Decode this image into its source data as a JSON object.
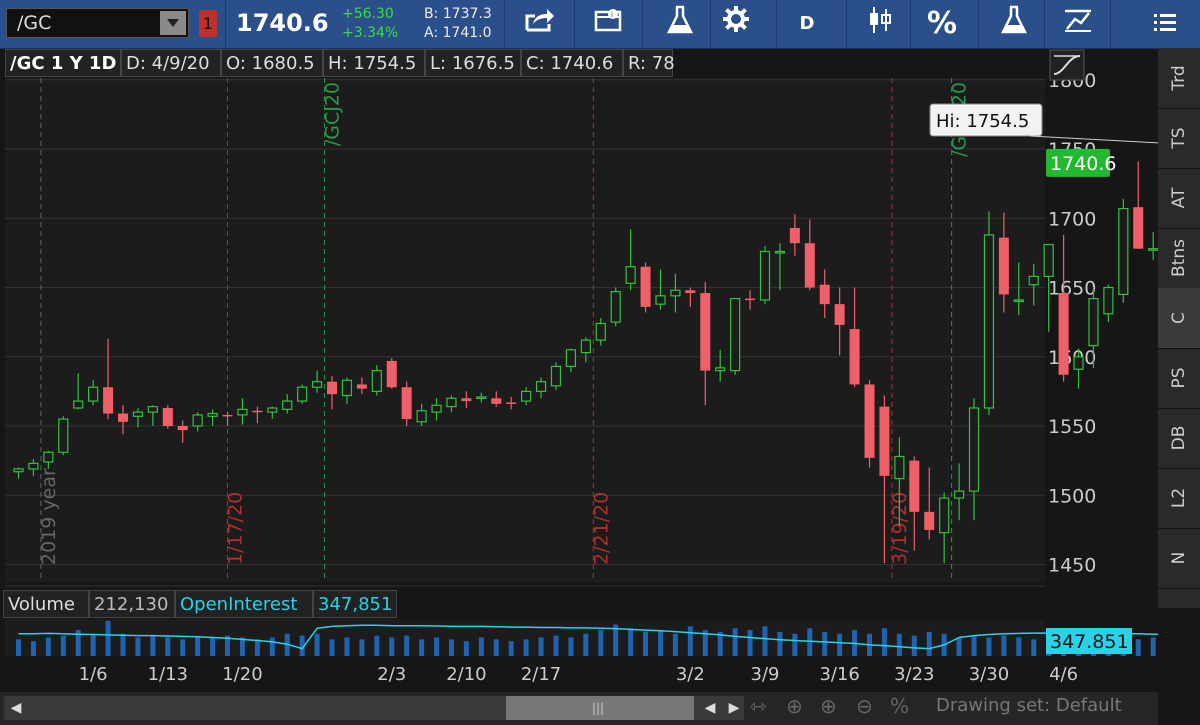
{
  "toolbar": {
    "symbol": "/GC",
    "link_badge": "1",
    "last_price": "1740.6",
    "net_change": "+56.30",
    "pct_change": "+3.34%",
    "bid": "B: 1737.3",
    "ask": "A: 1741.0",
    "aggregation_label": "D",
    "percent_label": "%"
  },
  "chart_header": {
    "title": "/GC 1 Y 1D",
    "date": "D: 4/9/20",
    "open": "O: 1680.5",
    "high": "H: 1754.5",
    "low": "L: 1676.5",
    "close": "C: 1740.6",
    "range": "R: 78"
  },
  "colors": {
    "up": "#35c040",
    "down": "#f06068",
    "grid": "#333333",
    "cyan": "#2ad2e8",
    "red_marker": "#b03030",
    "green_marker": "#2a9a4a",
    "price_badge": "#22b830"
  },
  "sidebar": {
    "tabs": [
      "Trd",
      "TS",
      "AT",
      "Btns",
      "C",
      "PS",
      "DB",
      "L2",
      "N"
    ],
    "active": "C"
  },
  "chart_data": {
    "type": "candlestick",
    "y_ticks": [
      1450,
      1500,
      1550,
      1600,
      1650,
      1700,
      1750,
      1800
    ],
    "ylim": [
      1440,
      1800
    ],
    "x_tick_labels": [
      "1/6",
      "1/13",
      "1/20",
      "2/3",
      "2/10",
      "2/17",
      "3/2",
      "3/9",
      "3/16",
      "3/23",
      "3/30",
      "4/6"
    ],
    "x_tick_indices": [
      5,
      10,
      15,
      25,
      30,
      35,
      45,
      50,
      55,
      60,
      65,
      70
    ],
    "high_annotation": "Hi: 1754.5",
    "last_price_label": "1740.6",
    "markers": [
      {
        "label": "2019 year",
        "index": 1.5,
        "color": "gray"
      },
      {
        "label": "1/17/20",
        "index": 14,
        "color": "red"
      },
      {
        "label": "/GCJ20",
        "index": 20.5,
        "color": "green"
      },
      {
        "label": "2/21/20",
        "index": 38.5,
        "color": "red"
      },
      {
        "label": "3/19/20",
        "index": 58.5,
        "color": "red"
      },
      {
        "label": "/GCM20",
        "index": 62.5,
        "color": "green"
      }
    ],
    "candles": [
      {
        "o": 1517,
        "h": 1520,
        "l": 1512,
        "c": 1519
      },
      {
        "o": 1519,
        "h": 1526,
        "l": 1514,
        "c": 1523
      },
      {
        "o": 1524,
        "h": 1532,
        "l": 1519,
        "c": 1531
      },
      {
        "o": 1531,
        "h": 1557,
        "l": 1529,
        "c": 1555
      },
      {
        "o": 1563,
        "h": 1588,
        "l": 1562,
        "c": 1568
      },
      {
        "o": 1568,
        "h": 1583,
        "l": 1565,
        "c": 1578
      },
      {
        "o": 1578,
        "h": 1613,
        "l": 1555,
        "c": 1559
      },
      {
        "o": 1559,
        "h": 1565,
        "l": 1544,
        "c": 1553
      },
      {
        "o": 1557,
        "h": 1563,
        "l": 1549,
        "c": 1560
      },
      {
        "o": 1560,
        "h": 1565,
        "l": 1550,
        "c": 1564
      },
      {
        "o": 1563,
        "h": 1565,
        "l": 1548,
        "c": 1550
      },
      {
        "o": 1550,
        "h": 1554,
        "l": 1538,
        "c": 1547
      },
      {
        "o": 1550,
        "h": 1560,
        "l": 1546,
        "c": 1558
      },
      {
        "o": 1557,
        "h": 1562,
        "l": 1550,
        "c": 1559
      },
      {
        "o": 1558,
        "h": 1560,
        "l": 1550,
        "c": 1557
      },
      {
        "o": 1558,
        "h": 1570,
        "l": 1551,
        "c": 1562
      },
      {
        "o": 1561,
        "h": 1564,
        "l": 1552,
        "c": 1560
      },
      {
        "o": 1560,
        "h": 1564,
        "l": 1555,
        "c": 1563
      },
      {
        "o": 1562,
        "h": 1573,
        "l": 1559,
        "c": 1568
      },
      {
        "o": 1568,
        "h": 1580,
        "l": 1566,
        "c": 1578
      },
      {
        "o": 1578,
        "h": 1590,
        "l": 1574,
        "c": 1582
      },
      {
        "o": 1582,
        "h": 1586,
        "l": 1562,
        "c": 1573
      },
      {
        "o": 1572,
        "h": 1585,
        "l": 1566,
        "c": 1583
      },
      {
        "o": 1580,
        "h": 1585,
        "l": 1573,
        "c": 1577
      },
      {
        "o": 1575,
        "h": 1594,
        "l": 1572,
        "c": 1590
      },
      {
        "o": 1597,
        "h": 1599,
        "l": 1577,
        "c": 1578
      },
      {
        "o": 1578,
        "h": 1582,
        "l": 1550,
        "c": 1555
      },
      {
        "o": 1553,
        "h": 1566,
        "l": 1550,
        "c": 1561
      },
      {
        "o": 1560,
        "h": 1570,
        "l": 1554,
        "c": 1565
      },
      {
        "o": 1564,
        "h": 1572,
        "l": 1560,
        "c": 1570
      },
      {
        "o": 1570,
        "h": 1575,
        "l": 1563,
        "c": 1568
      },
      {
        "o": 1570,
        "h": 1574,
        "l": 1567,
        "c": 1571
      },
      {
        "o": 1570,
        "h": 1575,
        "l": 1564,
        "c": 1566
      },
      {
        "o": 1567,
        "h": 1571,
        "l": 1562,
        "c": 1566
      },
      {
        "o": 1568,
        "h": 1578,
        "l": 1565,
        "c": 1575
      },
      {
        "o": 1575,
        "h": 1585,
        "l": 1570,
        "c": 1582
      },
      {
        "o": 1579,
        "h": 1596,
        "l": 1576,
        "c": 1593
      },
      {
        "o": 1593,
        "h": 1606,
        "l": 1589,
        "c": 1605
      },
      {
        "o": 1603,
        "h": 1614,
        "l": 1596,
        "c": 1612
      },
      {
        "o": 1612,
        "h": 1628,
        "l": 1608,
        "c": 1624
      },
      {
        "o": 1625,
        "h": 1650,
        "l": 1622,
        "c": 1647
      },
      {
        "o": 1653,
        "h": 1692,
        "l": 1648,
        "c": 1665
      },
      {
        "o": 1665,
        "h": 1668,
        "l": 1632,
        "c": 1636
      },
      {
        "o": 1638,
        "h": 1663,
        "l": 1634,
        "c": 1644
      },
      {
        "o": 1644,
        "h": 1660,
        "l": 1632,
        "c": 1648
      },
      {
        "o": 1648,
        "h": 1650,
        "l": 1636,
        "c": 1646
      },
      {
        "o": 1646,
        "h": 1654,
        "l": 1565,
        "c": 1590
      },
      {
        "o": 1590,
        "h": 1605,
        "l": 1582,
        "c": 1592
      },
      {
        "o": 1590,
        "h": 1641,
        "l": 1587,
        "c": 1642
      },
      {
        "o": 1642,
        "h": 1648,
        "l": 1634,
        "c": 1641
      },
      {
        "o": 1641,
        "h": 1680,
        "l": 1638,
        "c": 1676
      },
      {
        "o": 1675,
        "h": 1682,
        "l": 1648,
        "c": 1676
      },
      {
        "o": 1693,
        "h": 1703,
        "l": 1673,
        "c": 1682
      },
      {
        "o": 1682,
        "h": 1699,
        "l": 1648,
        "c": 1650
      },
      {
        "o": 1652,
        "h": 1663,
        "l": 1628,
        "c": 1638
      },
      {
        "o": 1638,
        "h": 1650,
        "l": 1601,
        "c": 1623
      },
      {
        "o": 1620,
        "h": 1650,
        "l": 1578,
        "c": 1580
      },
      {
        "o": 1580,
        "h": 1583,
        "l": 1520,
        "c": 1527
      },
      {
        "o": 1564,
        "h": 1572,
        "l": 1451,
        "c": 1514
      },
      {
        "o": 1512,
        "h": 1542,
        "l": 1478,
        "c": 1528
      },
      {
        "o": 1525,
        "h": 1528,
        "l": 1460,
        "c": 1488
      },
      {
        "o": 1488,
        "h": 1520,
        "l": 1468,
        "c": 1475
      },
      {
        "o": 1473,
        "h": 1502,
        "l": 1451,
        "c": 1498
      },
      {
        "o": 1498,
        "h": 1523,
        "l": 1482,
        "c": 1503
      },
      {
        "o": 1503,
        "h": 1570,
        "l": 1482,
        "c": 1563
      },
      {
        "o": 1563,
        "h": 1705,
        "l": 1558,
        "c": 1688
      },
      {
        "o": 1686,
        "h": 1704,
        "l": 1632,
        "c": 1645
      },
      {
        "o": 1640,
        "h": 1668,
        "l": 1630,
        "c": 1641
      },
      {
        "o": 1652,
        "h": 1667,
        "l": 1637,
        "c": 1658
      },
      {
        "o": 1658,
        "h": 1670,
        "l": 1618,
        "c": 1681
      },
      {
        "o": 1646,
        "h": 1688,
        "l": 1582,
        "c": 1587
      },
      {
        "o": 1591,
        "h": 1606,
        "l": 1577,
        "c": 1600
      },
      {
        "o": 1608,
        "h": 1650,
        "l": 1592,
        "c": 1642
      },
      {
        "o": 1631,
        "h": 1652,
        "l": 1625,
        "c": 1650
      },
      {
        "o": 1645,
        "h": 1714,
        "l": 1639,
        "c": 1707
      },
      {
        "o": 1708,
        "h": 1741,
        "l": 1678,
        "c": 1678
      },
      {
        "o": 1678,
        "h": 1690,
        "l": 1670,
        "c": 1678
      },
      {
        "o": 1680,
        "h": 1754,
        "l": 1676,
        "c": 1740
      }
    ]
  },
  "volume_panel": {
    "label": "Volume",
    "volume_value": "212,130",
    "oi_label": "OpenInterest",
    "oi_value": "347,851",
    "oi_badge": "347.851",
    "volume_bars": [
      0.45,
      0.4,
      0.5,
      0.55,
      0.7,
      0.6,
      0.95,
      0.6,
      0.5,
      0.55,
      0.5,
      0.45,
      0.5,
      0.5,
      0.55,
      0.5,
      0.45,
      0.5,
      0.6,
      0.55,
      0.6,
      0.45,
      0.5,
      0.45,
      0.55,
      0.5,
      0.55,
      0.45,
      0.5,
      0.45,
      0.4,
      0.5,
      0.45,
      0.4,
      0.45,
      0.5,
      0.55,
      0.5,
      0.6,
      0.7,
      0.85,
      0.75,
      0.65,
      0.7,
      0.6,
      0.8,
      0.7,
      0.65,
      0.75,
      0.7,
      0.8,
      0.65,
      0.6,
      0.75,
      0.65,
      0.6,
      0.7,
      0.6,
      0.75,
      0.6,
      0.55,
      0.65,
      0.6,
      0.5,
      0.55,
      0.5,
      0.55,
      0.5,
      0.45,
      0.55,
      0.5,
      0.5,
      0.45,
      0.5,
      0.55,
      0.45,
      0.5,
      0.6
    ],
    "oi_line": [
      0.6,
      0.6,
      0.61,
      0.6,
      0.59,
      0.58,
      0.57,
      0.56,
      0.55,
      0.55,
      0.54,
      0.53,
      0.52,
      0.5,
      0.48,
      0.45,
      0.42,
      0.38,
      0.32,
      0.2,
      0.75,
      0.8,
      0.82,
      0.83,
      0.83,
      0.82,
      0.82,
      0.82,
      0.81,
      0.8,
      0.8,
      0.8,
      0.79,
      0.78,
      0.78,
      0.77,
      0.77,
      0.76,
      0.76,
      0.75,
      0.74,
      0.72,
      0.7,
      0.68,
      0.66,
      0.63,
      0.6,
      0.57,
      0.53,
      0.5,
      0.47,
      0.44,
      0.42,
      0.4,
      0.38,
      0.36,
      0.34,
      0.3,
      0.28,
      0.25,
      0.22,
      0.2,
      0.3,
      0.5,
      0.55,
      0.58,
      0.6,
      0.61,
      0.62,
      0.62,
      0.62,
      0.61,
      0.61,
      0.6,
      0.6,
      0.6,
      0.59,
      0.58
    ]
  },
  "bottom_bar": {
    "drawing_set": "Drawing set: Default"
  }
}
